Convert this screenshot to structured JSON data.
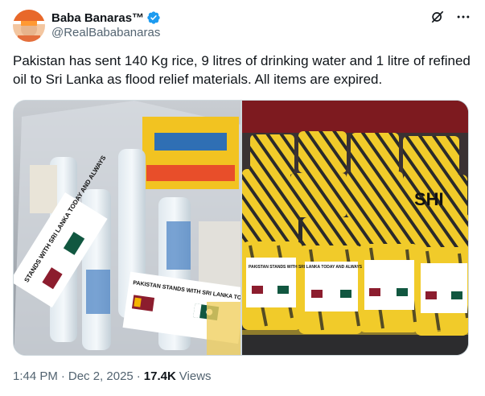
{
  "author": {
    "display_name": "Baba Banaras™",
    "handle": "@RealBababanaras",
    "verified": true
  },
  "tweet": {
    "text": "Pakistan has sent 140 Kg rice, 9 litres of drinking water and 1 litre of refined oil to Sri Lanka as flood relief materials. All items are expired.",
    "time": "1:44 PM",
    "separator": "·",
    "date": "Dec 2, 2025",
    "views_count": "17.4K",
    "views_label": "Views"
  },
  "media": {
    "left_photo": {
      "banner_text": "PAKISTAN STANDS WITH SRI LANKA TODAY AND ALWAYS",
      "label_text": "STANDS WITH SRI LANKA TODAY AND ALWAYS"
    },
    "right_photo": {
      "brand_text": "SHI",
      "label_text": "PAKISTAN STANDS WITH SRI LANKA TODAY AND ALWAYS"
    }
  },
  "icons": {
    "verified": "verified-badge-icon",
    "grok": "grok-icon",
    "more": "more-icon"
  },
  "colors": {
    "verified_blue": "#1d9bf0",
    "text_primary": "#0f1419",
    "text_secondary": "#536471",
    "border": "#cfd9de"
  }
}
